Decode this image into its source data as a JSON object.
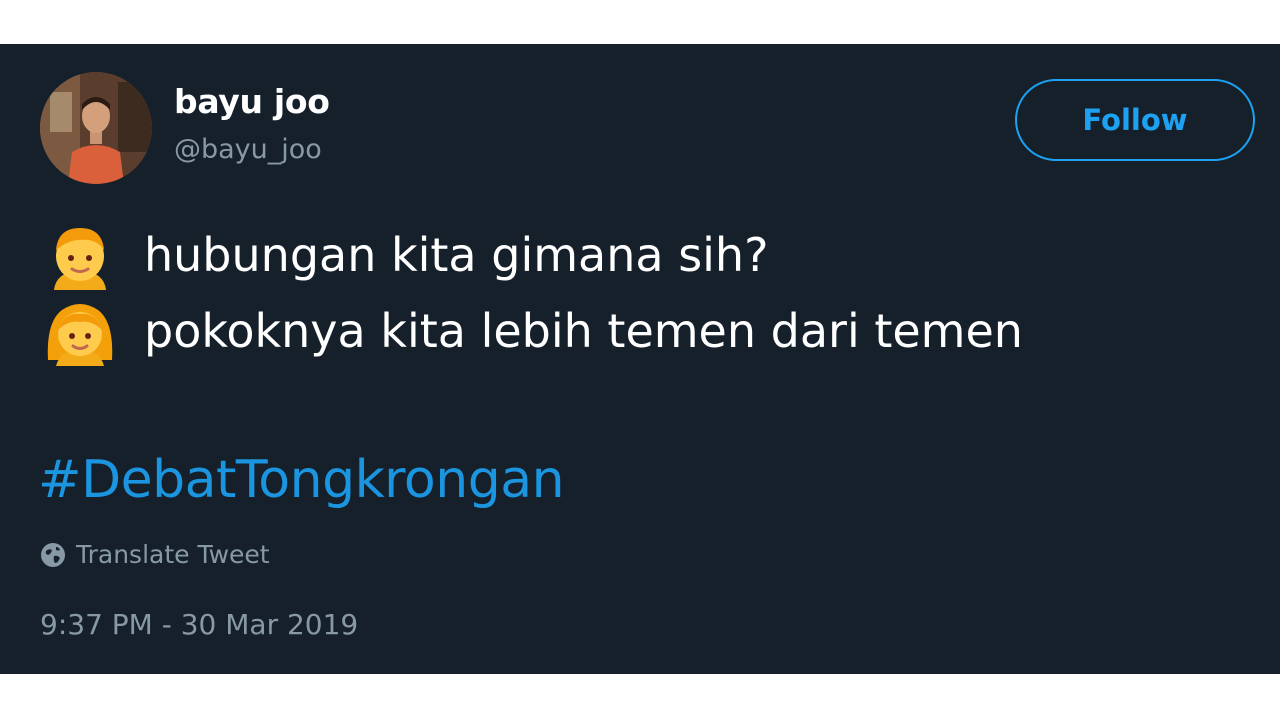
{
  "user": {
    "display_name": "bayu joo",
    "handle": "@bayu_joo",
    "avatar_icon": "profile-photo"
  },
  "follow_button": {
    "label": "Follow"
  },
  "tweet": {
    "lines": [
      {
        "emoji": "boy-emoji",
        "text": "hubungan kita gimana sih?"
      },
      {
        "emoji": "girl-emoji",
        "text": "pokoknya kita lebih temen dari temen"
      }
    ],
    "hashtag": "#DebatTongkrongan"
  },
  "translate": {
    "label": "Translate Tweet",
    "icon": "globe-icon"
  },
  "timestamp": "9:37 PM - 30 Mar 2019",
  "colors": {
    "background": "#15202b",
    "accent": "#1da1f2",
    "hashtag": "#1b95e0",
    "muted": "#8899a6"
  }
}
